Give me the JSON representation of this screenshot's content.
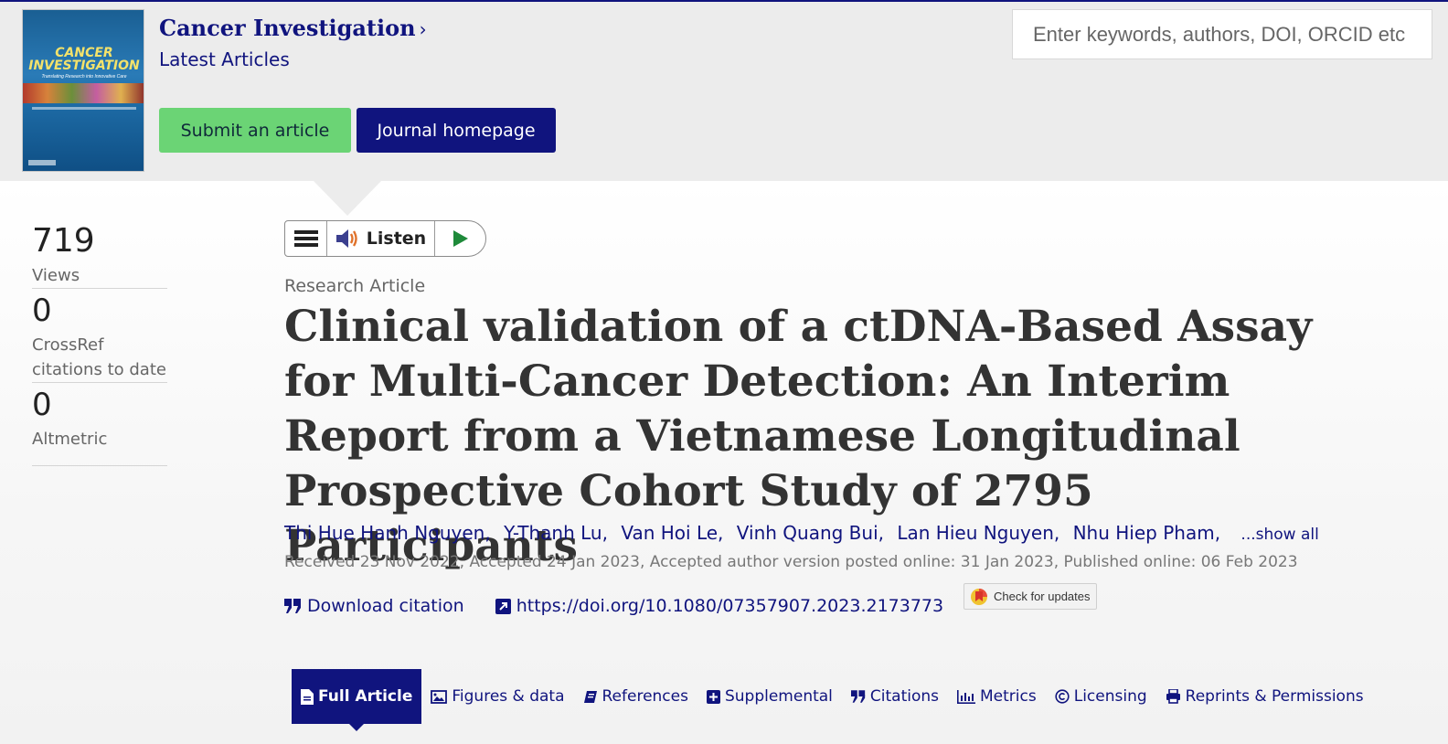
{
  "journal": {
    "cover_title": "CANCER INVESTIGATION",
    "cover_subtitle": "Translating Research into Innovative Care",
    "title": "Cancer Investigation",
    "chevron": "›",
    "latest": "Latest Articles",
    "submit_label": "Submit an article",
    "homepage_label": "Journal homepage"
  },
  "search": {
    "placeholder": "Enter keywords, authors, DOI, ORCID etc"
  },
  "metrics": [
    {
      "value": "719",
      "label": "Views"
    },
    {
      "value": "0",
      "label": "CrossRef citations to date"
    },
    {
      "value": "0",
      "label": "Altmetric"
    }
  ],
  "listen": {
    "label": "Listen"
  },
  "article": {
    "type": "Research Article",
    "title": "Clinical validation of a ctDNA-Based Assay for Multi-Cancer Detection: An Interim Report from a Vietnamese Longitudinal Prospective Cohort Study of 2795 Participants",
    "authors": [
      "Thi Hue Hanh Nguyen",
      "Y-Thanh Lu",
      "Van Hoi Le",
      "Vinh Quang Bui",
      "Lan Hieu Nguyen",
      "Nhu Hiep Pham"
    ],
    "show_all": "...show all",
    "dates": "Received 23 Nov 2022, Accepted 24 Jan 2023, Accepted author version posted online: 31 Jan 2023, Published online: 06 Feb 2023",
    "download_citation": "Download citation",
    "doi": "https://doi.org/10.1080/07357907.2023.2173773",
    "check_updates": "Check for updates"
  },
  "tabs": [
    {
      "label": "Full Article",
      "icon": "document-icon",
      "active": true
    },
    {
      "label": "Figures & data",
      "icon": "image-icon"
    },
    {
      "label": "References",
      "icon": "book-icon"
    },
    {
      "label": "Supplemental",
      "icon": "plus-square-icon"
    },
    {
      "label": "Citations",
      "icon": "quote-icon"
    },
    {
      "label": "Metrics",
      "icon": "bar-chart-icon"
    },
    {
      "label": "Licensing",
      "icon": "copyright-icon"
    },
    {
      "label": "Reprints & Permissions",
      "icon": "print-icon"
    }
  ],
  "colors": {
    "navy": "#10147e",
    "green": "#6bd475",
    "header_bg": "#ececec"
  }
}
